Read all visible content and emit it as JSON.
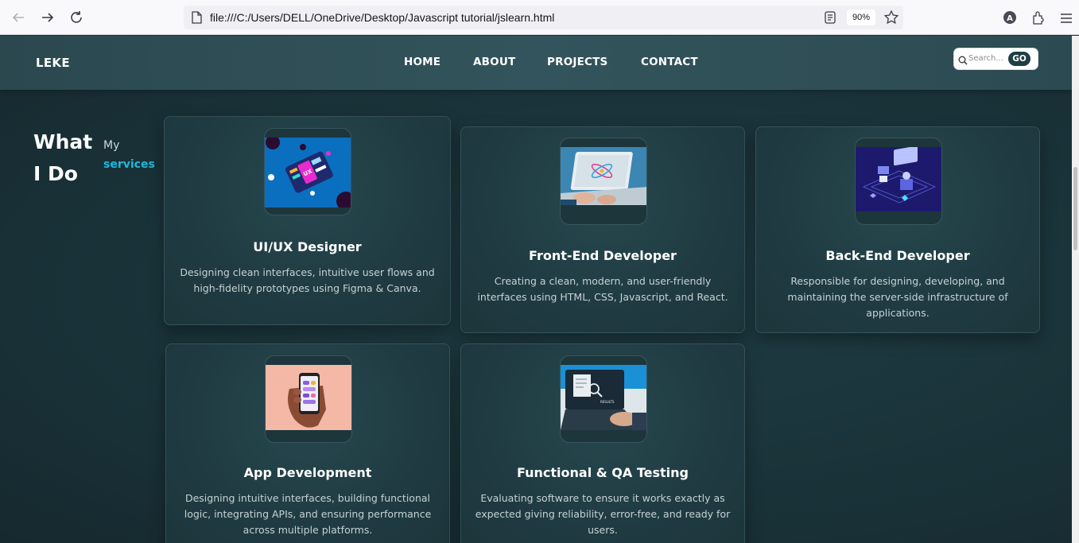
{
  "browser": {
    "url": "file:///C:/Users/DELL/OneDrive/Desktop/Javascript tutorial/jslearn.html",
    "zoom": "90%",
    "icons": [
      "back-icon",
      "forward-icon",
      "reload-icon",
      "page-icon",
      "reader-view-icon",
      "bookmark-star-icon",
      "account-icon",
      "extensions-icon",
      "menu-icon"
    ]
  },
  "header": {
    "logo": "LEKE",
    "nav": [
      "HOME",
      "ABOUT",
      "PROJECTS",
      "CONTACT"
    ],
    "search": {
      "placeholder": "Search...",
      "button": "GO"
    }
  },
  "section": {
    "heading_line1": "What",
    "heading_line2": "I Do",
    "sub_line1": "My",
    "sub_line2": "services",
    "accent_color": "#1fb8dc"
  },
  "cards": [
    {
      "title": "UI/UX Designer",
      "desc_lines": [
        "Designing clean interfaces, intuitive user flows and",
        "high-fidelity prototypes using Figma & Canva."
      ]
    },
    {
      "title": "Front-End Developer",
      "desc_lines": [
        "Creating a clean, modern, and user-friendly",
        "interfaces using HTML, CSS, Javascript, and React."
      ]
    },
    {
      "title": "Back-End Developer",
      "desc_lines": [
        "Responsible for designing, developing, and",
        "maintaining the server-side infrastructure of",
        "applications."
      ]
    },
    {
      "title": "App Development",
      "desc_lines": [
        "Designing intuitive interfaces, building functional",
        "logic, integrating APIs, and ensuring performance",
        "across multiple platforms."
      ]
    },
    {
      "title": "Functional & QA Testing",
      "desc_lines": [
        "Evaluating software to ensure it works exactly as",
        "expected giving reliability, error-free, and ready for",
        "users."
      ]
    }
  ]
}
